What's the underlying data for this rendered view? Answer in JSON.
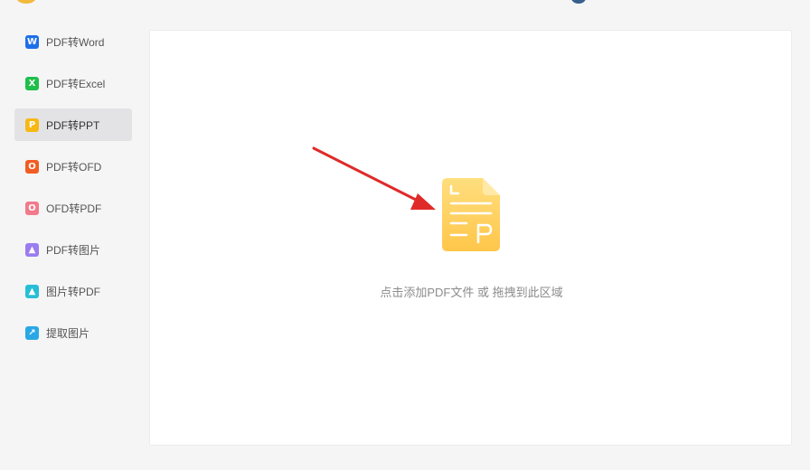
{
  "sidebar": {
    "items": [
      {
        "label": "PDF转Word",
        "icon": "word-icon",
        "icon_glyph": "W",
        "color": "#1e6fe8",
        "active": false
      },
      {
        "label": "PDF转Excel",
        "icon": "excel-icon",
        "icon_glyph": "X",
        "color": "#1fbf4a",
        "active": false
      },
      {
        "label": "PDF转PPT",
        "icon": "ppt-icon",
        "icon_glyph": "P",
        "color": "#f7b814",
        "active": true
      },
      {
        "label": "PDF转OFD",
        "icon": "ofd-icon",
        "icon_glyph": "O",
        "color": "#f25d22",
        "active": false
      },
      {
        "label": "OFD转PDF",
        "icon": "ofd-to-pdf-icon",
        "icon_glyph": "O",
        "color": "#f27a8a",
        "active": false
      },
      {
        "label": "PDF转图片",
        "icon": "pdf-to-image-icon",
        "icon_glyph": "▲",
        "color": "#9b7cf0",
        "active": false
      },
      {
        "label": "图片转PDF",
        "icon": "image-to-pdf-icon",
        "icon_glyph": "▲",
        "color": "#27bfd6",
        "active": false
      },
      {
        "label": "提取图片",
        "icon": "extract-image-icon",
        "icon_glyph": "↗",
        "color": "#2aa8e6",
        "active": false
      }
    ]
  },
  "main": {
    "drop_hint": "点击添加PDF文件 或 拖拽到此区域",
    "file_icon": "ppt-file-icon",
    "file_icon_color": "#ffd36b",
    "arrow_color": "#e02a2a"
  }
}
